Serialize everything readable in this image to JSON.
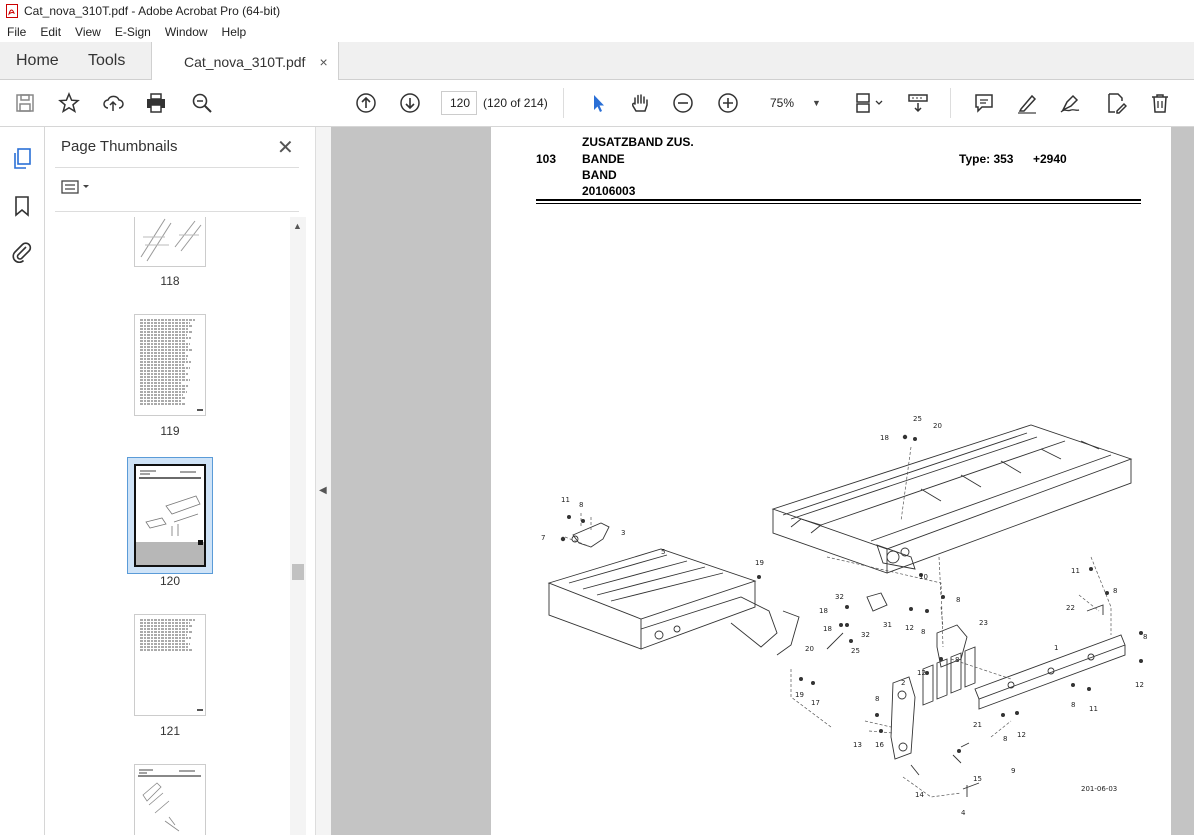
{
  "window": {
    "title": "Cat_nova_310T.pdf - Adobe Acrobat Pro (64-bit)"
  },
  "menu": [
    "File",
    "Edit",
    "View",
    "E-Sign",
    "Window",
    "Help"
  ],
  "tabs": {
    "home": "Home",
    "tools": "Tools",
    "document": "Cat_nova_310T.pdf",
    "close": "×"
  },
  "toolbar": {
    "page_number": "120",
    "page_count": "(120 of 214)",
    "zoom": "75%"
  },
  "panel": {
    "title": "Page Thumbnails",
    "close": "✕",
    "thumbnails": [
      {
        "label": "118"
      },
      {
        "label": "119"
      },
      {
        "label": "120",
        "selected": true
      },
      {
        "label": "121"
      },
      {
        "label": "122"
      }
    ]
  },
  "document_page": {
    "section_number": "103",
    "title_lines": [
      "ZUSATZBAND ZUS.",
      "BANDE",
      "BAND",
      "20106003"
    ],
    "type": "Type: 353",
    "code": "+2940",
    "drawing_ref": "201-06-03",
    "callouts": [
      "25",
      "20",
      "18",
      "11",
      "8",
      "3",
      "7",
      "5",
      "19",
      "10",
      "11",
      "8",
      "32",
      "8",
      "22",
      "8",
      "18",
      "31",
      "12",
      "8",
      "23",
      "18",
      "32",
      "1",
      "20",
      "25",
      "12",
      "8",
      "12",
      "19",
      "17",
      "2",
      "8",
      "8",
      "21",
      "13",
      "16",
      "8",
      "12",
      "11",
      "9",
      "14",
      "15",
      "4"
    ]
  }
}
